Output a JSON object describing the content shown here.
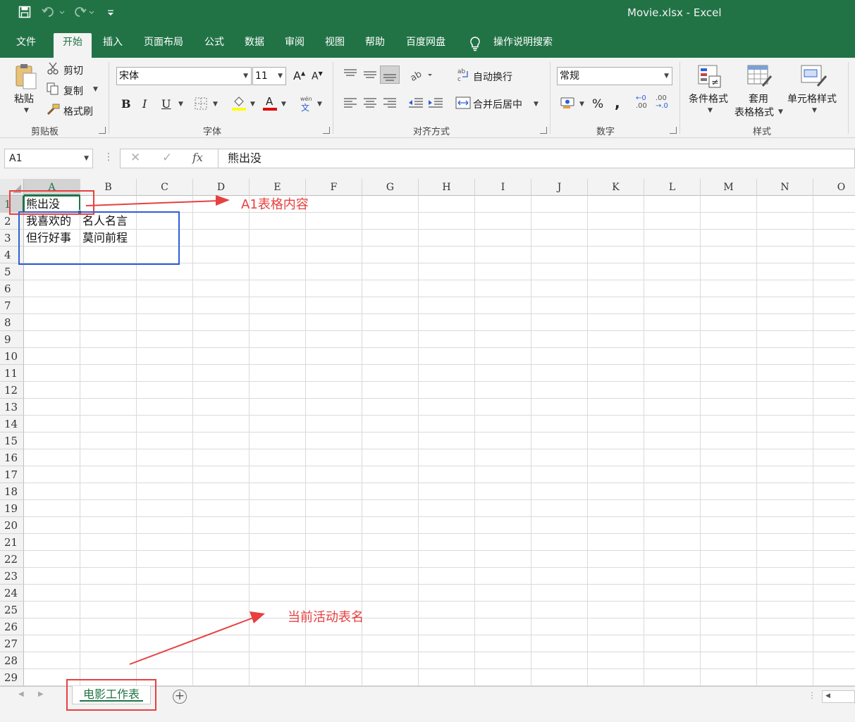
{
  "window": {
    "title": "Movie.xlsx  -  Excel"
  },
  "quick_access": {
    "save_icon": "save-icon",
    "undo_icon": "undo-icon",
    "redo_icon": "redo-icon",
    "customize_icon": "customize-qat-icon"
  },
  "tabs": [
    {
      "label": "文件"
    },
    {
      "label": "开始"
    },
    {
      "label": "插入"
    },
    {
      "label": "页面布局"
    },
    {
      "label": "公式"
    },
    {
      "label": "数据"
    },
    {
      "label": "审阅"
    },
    {
      "label": "视图"
    },
    {
      "label": "帮助"
    },
    {
      "label": "百度网盘"
    },
    {
      "label": "操作说明搜索"
    }
  ],
  "active_tab": "开始",
  "ribbon": {
    "clipboard": {
      "paste": "粘贴",
      "cut": "剪切",
      "copy": "复制",
      "format_painter": "格式刷",
      "group": "剪贴板"
    },
    "font": {
      "font_name": "宋体",
      "font_size": "11",
      "bold": "B",
      "italic": "I",
      "underline": "U",
      "group": "字体",
      "wen_top": "wén",
      "wen_bottom": "文"
    },
    "alignment": {
      "wrap_text": "自动换行",
      "merge_center": "合并后居中",
      "group": "对齐方式"
    },
    "number": {
      "format": "常规",
      "percent": "%",
      "comma": ",",
      "group": "数字",
      "inc_top": "←0",
      "inc_bottom": ".00",
      "dec_top": ".00",
      "dec_bottom": "→.0"
    },
    "styles": {
      "conditional": "条件格式",
      "table_top": "套用",
      "table_bottom": "表格格式",
      "cell_styles": "单元格样式",
      "group": "样式"
    }
  },
  "formula_bar": {
    "name_box": "A1",
    "cancel": "✕",
    "enter": "✓",
    "fx": "fx",
    "content": "熊出没"
  },
  "columns": [
    "A",
    "B",
    "C",
    "D",
    "E",
    "F",
    "G",
    "H",
    "I",
    "J",
    "K",
    "L",
    "M",
    "N",
    "O"
  ],
  "rows": [
    "1",
    "2",
    "3",
    "4",
    "5",
    "6",
    "7",
    "8",
    "9",
    "10",
    "11",
    "12",
    "13",
    "14",
    "15",
    "16",
    "17",
    "18",
    "19",
    "20",
    "21",
    "22",
    "23",
    "24",
    "25",
    "26",
    "27",
    "28",
    "29"
  ],
  "cells": {
    "A1": "熊出没",
    "A2": "我喜欢的",
    "B2": "名人名言",
    "A3": "但行好事",
    "B3": "莫问前程"
  },
  "annotations": {
    "a1_content": "A1表格内容",
    "active_sheet": "当前活动表名",
    "red": "#e84040",
    "blue": "#2f5fd6"
  },
  "sheet_tabs": [
    {
      "label": "电影工作表"
    }
  ],
  "colors": {
    "excel_green": "#217346",
    "ribbon_bg": "#f3f3f3"
  }
}
